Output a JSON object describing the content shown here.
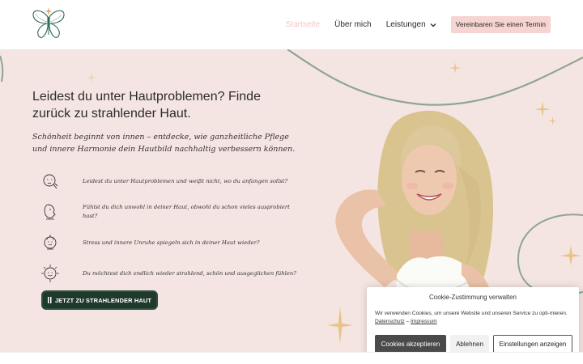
{
  "nav": {
    "items": [
      {
        "label": "Startseite",
        "active": true
      },
      {
        "label": "Über mich",
        "active": false
      },
      {
        "label": "Leistungen",
        "active": false,
        "dropdown": true
      }
    ],
    "cta_label": "Vereinbaren Sie einen Termin"
  },
  "hero": {
    "headline": "Leidest du unter Hautproblemen? Finde zurück zu strahlender Haut.",
    "tagline": "Schönheit beginnt von innen – entdecke, wie ganzheitliche Pflege und innere Harmonie dein Hautbild nachhaltig verbessern können.",
    "benefits": [
      {
        "icon": "face-touch-icon",
        "text": "Leidest du unter Hautproblemen und weißt nicht, wo du anfangen sollst?"
      },
      {
        "icon": "face-profile-icon",
        "text": "Fühlst du dich unwohl in deiner Haut, obwohl du schon vieles ausprobiert hast?"
      },
      {
        "icon": "face-stress-icon",
        "text": "Stress und innere Unruhe spiegeln sich in deiner Haut wieder?"
      },
      {
        "icon": "face-glow-icon",
        "text": "Du möchtest dich endlich wieder strahlend, schön und ausgeglichen fühlen?"
      }
    ],
    "button_label": "JETZT ZU STRAHLENDER HAUT",
    "button_icon": "menu-icon"
  },
  "cookie": {
    "title": "Cookie-Zustimmung verwalten",
    "text": "Wir verwenden Cookies, um unsere Website und unseren Service zu opti-mieren.",
    "link_privacy": "Datenschutz",
    "separator": "–",
    "link_imprint": "Impressum",
    "accept_label": "Cookies akzeptieren",
    "deny_label": "Ablehnen",
    "settings_label": "Einstellungen anzeigen"
  },
  "colors": {
    "hero_bg": "#f5e5e2",
    "accent_pink": "#f6d4d1",
    "button_green": "#1f3a2d",
    "sparkle_gold": "#e8c48a",
    "line_sage": "#8fa592"
  }
}
